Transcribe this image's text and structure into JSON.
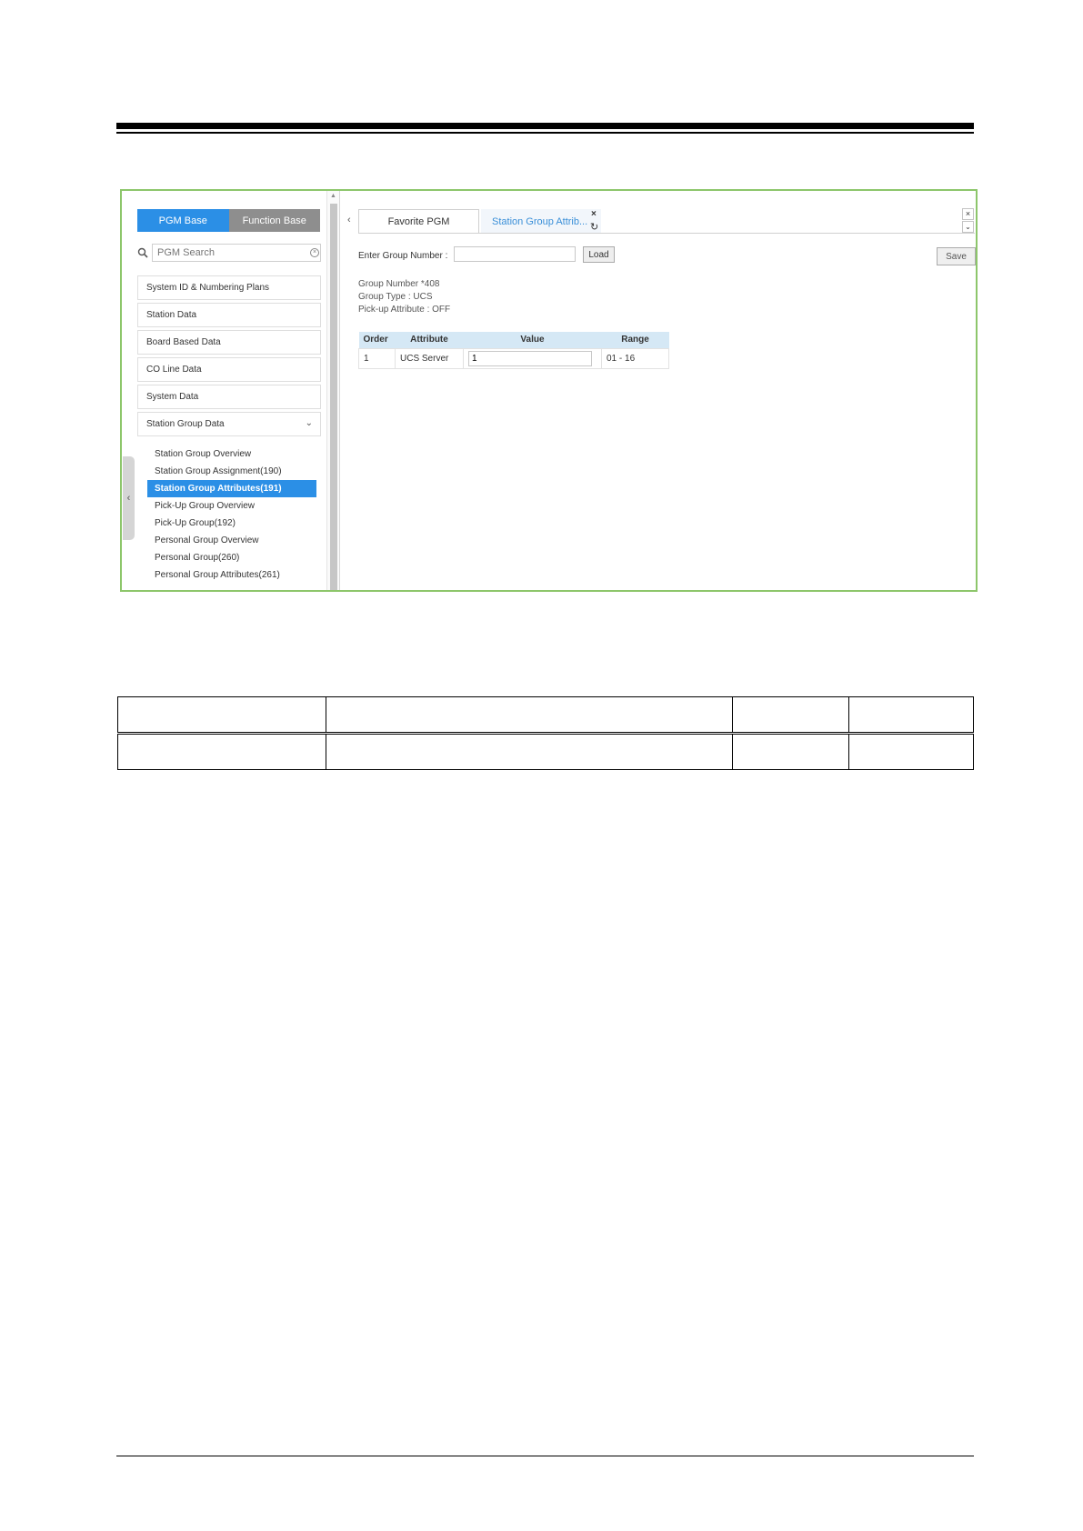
{
  "left_panel": {
    "toggle": {
      "pgm_base": "PGM Base",
      "function_base": "Function Base"
    },
    "search": {
      "placeholder": "PGM Search"
    },
    "menu": [
      {
        "label": "System ID & Numbering Plans"
      },
      {
        "label": "Station Data"
      },
      {
        "label": "Board Based Data"
      },
      {
        "label": "CO Line Data"
      },
      {
        "label": "System Data"
      },
      {
        "label": "Station Group Data"
      }
    ],
    "submenu": [
      {
        "label": "Station Group Overview"
      },
      {
        "label": "Station Group Assignment(190)"
      },
      {
        "label": "Station Group Attributes(191)"
      },
      {
        "label": "Pick-Up Group Overview"
      },
      {
        "label": "Pick-Up Group(192)"
      },
      {
        "label": "Personal Group Overview"
      },
      {
        "label": "Personal Group(260)"
      },
      {
        "label": "Personal Group Attributes(261)"
      }
    ],
    "selected_submenu": "Station Group Attributes(191)"
  },
  "tabs": [
    {
      "label": "Favorite PGM"
    },
    {
      "label": "Station Group Attrib..."
    }
  ],
  "form": {
    "group_number_label": "Enter Group Number :",
    "group_number_value": "",
    "load_label": "Load",
    "save_label": "Save"
  },
  "info": {
    "group_number": "Group Number *408",
    "group_type": "Group Type : UCS",
    "pickup_attribute": "Pick-up Attribute : OFF"
  },
  "attr_table": {
    "headers": [
      "Order",
      "Attribute",
      "Value",
      "Range"
    ],
    "rows": [
      {
        "order": "1",
        "attribute": "UCS Server",
        "value": "1",
        "range": "01 - 16"
      }
    ]
  },
  "colors": {
    "frame_border": "#8dc66b",
    "accent": "#2b8fe6",
    "table_header": "#d5e8f5"
  }
}
